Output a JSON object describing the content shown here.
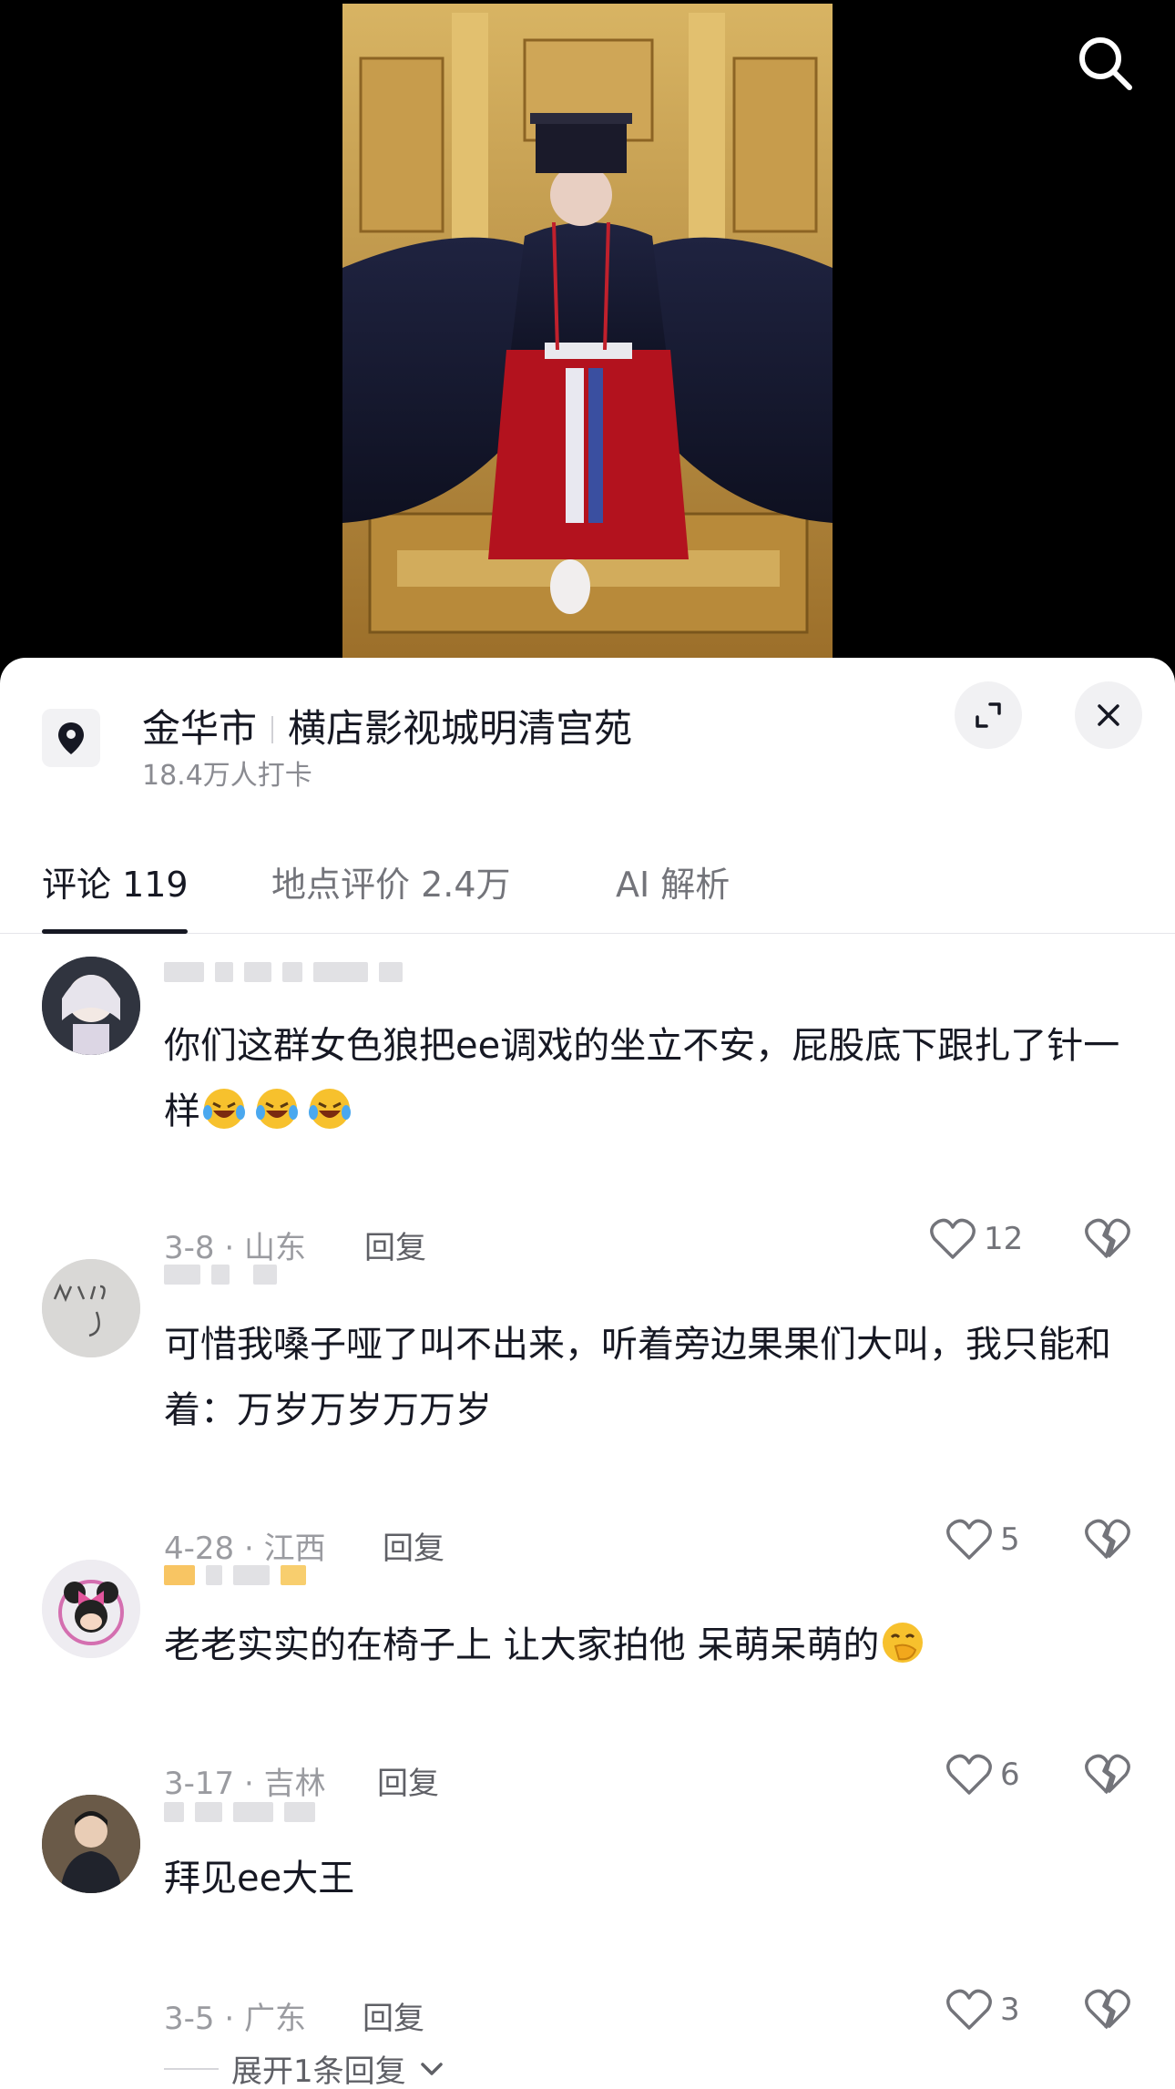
{
  "location": {
    "city": "金华市",
    "place": "横店影视城明清宫苑",
    "checkins": "18.4万人打卡"
  },
  "tabs": [
    {
      "label": "评论 119"
    },
    {
      "label": "地点评价 2.4万"
    },
    {
      "label": "AI 解析"
    }
  ],
  "comments": [
    {
      "text_before": "你们这群女色狼把ee调戏的坐立不安，屁股底下跟扎了针一样",
      "emoji": [
        "laugh-cry",
        "laugh-cry",
        "laugh-cry"
      ],
      "text_after": "",
      "date_region": "3-8 · 山东",
      "reply_label": "回复",
      "likes": "12"
    },
    {
      "text_before": "可惜我嗓子哑了叫不出来，听着旁边果果们大叫，我只能和着：万岁万岁万万岁",
      "emoji": [],
      "text_after": "",
      "date_region": "4-28 · 江西",
      "reply_label": "回复",
      "likes": "5"
    },
    {
      "text_before": "老老实实的在椅子上 让大家拍他 呆萌呆萌的",
      "emoji": [
        "hand-over-mouth"
      ],
      "text_after": "",
      "date_region": "3-17 · 吉林",
      "reply_label": "回复",
      "likes": "6"
    },
    {
      "text_before": "拜见ee大王",
      "emoji": [],
      "text_after": "",
      "date_region": "3-5 · 广东",
      "reply_label": "回复",
      "likes": "3"
    }
  ],
  "expand_replies_label": "展开1条回复",
  "icons": {
    "search": "search-icon",
    "location": "location-pin-icon",
    "expand": "expand-icon",
    "close": "close-icon",
    "like": "heart-icon",
    "dislike": "broken-heart-icon",
    "chevron": "chevron-down-icon"
  },
  "colors": {
    "text_primary": "#161823",
    "text_secondary": "#8a8b91",
    "sheet_bg": "#ffffff",
    "video_bg": "#000000"
  }
}
